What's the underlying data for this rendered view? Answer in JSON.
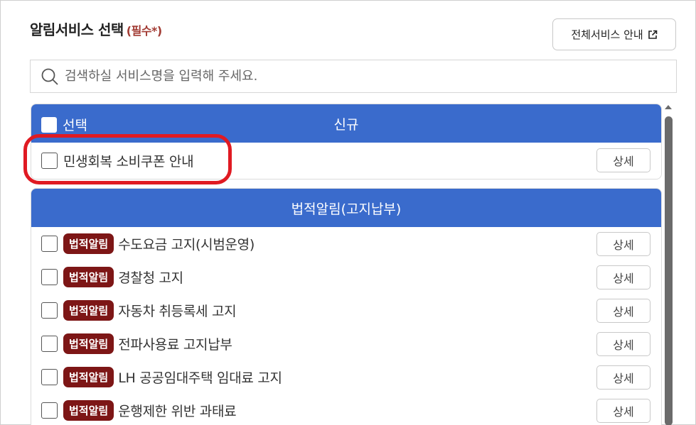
{
  "header": {
    "title": "알림서비스 선택",
    "required": "(필수*)",
    "all_services_label": "전체서비스 안내"
  },
  "search": {
    "placeholder": "검색하실 서비스명을 입력해 주세요."
  },
  "new_section": {
    "select_label": "선택",
    "title": "신규",
    "items": [
      {
        "label": "민생회복 소비쿠폰 안내",
        "detail": "상세"
      }
    ]
  },
  "legal_section": {
    "title": "법적알림(고지납부)",
    "items": [
      {
        "badge": "법적알림",
        "label": "수도요금 고지(시범운영)",
        "detail": "상세"
      },
      {
        "badge": "법적알림",
        "label": "경찰청 고지",
        "detail": "상세"
      },
      {
        "badge": "법적알림",
        "label": "자동차 취등록세 고지",
        "detail": "상세"
      },
      {
        "badge": "법적알림",
        "label": "전파사용료 고지납부",
        "detail": "상세"
      },
      {
        "badge": "법적알림",
        "label": "LH 공공임대주택 임대료 고지",
        "detail": "상세"
      },
      {
        "badge": "법적알림",
        "label": "운행제한 위반 과태료",
        "detail": "상세"
      }
    ]
  },
  "colors": {
    "header_blue": "#3a6bcc",
    "badge_red": "#7d1616",
    "required_red": "#a23b33",
    "highlight_red": "#e01a22"
  }
}
